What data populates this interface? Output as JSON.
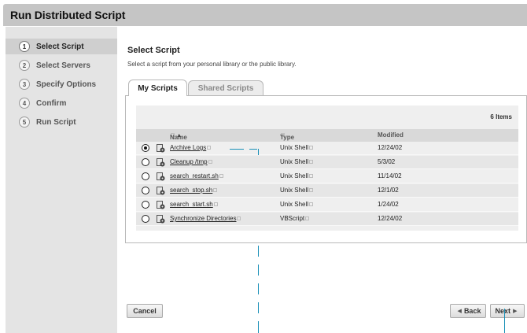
{
  "window": {
    "title": "Run Distributed Script"
  },
  "steps": [
    {
      "num": "1",
      "label": "Select Script"
    },
    {
      "num": "2",
      "label": "Select Servers"
    },
    {
      "num": "3",
      "label": "Specify Options"
    },
    {
      "num": "4",
      "label": "Confirm"
    },
    {
      "num": "5",
      "label": "Run Script"
    }
  ],
  "main": {
    "title": "Select Script",
    "subtitle": "Select a script from your personal library or the public library.",
    "tabs": [
      {
        "label": "My Scripts",
        "selected": true
      },
      {
        "label": "Shared Scripts",
        "selected": false
      }
    ],
    "item_count": "6 Items",
    "columns": {
      "name": "Name",
      "type": "Type",
      "modified": "Modified",
      "sort_indicator": "▲"
    },
    "rows": [
      {
        "name": "Archive Logs",
        "type": "Unix Shell",
        "modified": "12/24/02",
        "selected": true
      },
      {
        "name": "Cleanup /tmp",
        "type": "Unix Shell",
        "modified": "5/3/02",
        "selected": false
      },
      {
        "name": "search_restart.sh",
        "type": "Unix Shell",
        "modified": "11/14/02",
        "selected": false
      },
      {
        "name": "search_stop.sh",
        "type": "Unix Shell",
        "modified": "12/1/02",
        "selected": false
      },
      {
        "name": "search_start.sh",
        "type": "Unix Shell",
        "modified": "1/24/02",
        "selected": false
      },
      {
        "name": "Synchronize Directories",
        "type": "VBScript",
        "modified": "12/24/02",
        "selected": false
      }
    ]
  },
  "buttons": {
    "cancel": "Cancel",
    "back": "Back",
    "next": "Next"
  },
  "icons": {
    "script": "script-gear-icon",
    "back": "left-arrow-icon",
    "next": "right-arrow-icon"
  },
  "colors": {
    "titlebar": "#c5c5c5",
    "sidebar": "#e4e4e4",
    "active_step": "#cfcfcf",
    "guide": "#1a90b8"
  }
}
